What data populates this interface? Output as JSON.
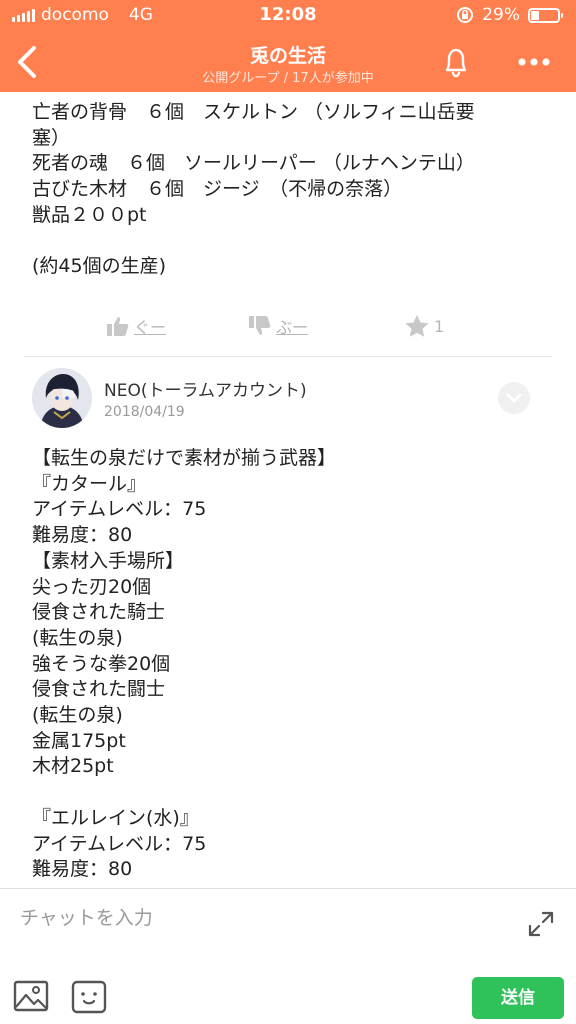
{
  "status_bar": {
    "carrier": "docomo",
    "network": "4G",
    "time": "12:08",
    "battery": "29%",
    "battery_level": 0.29
  },
  "nav": {
    "title": "兎の生活",
    "subtitle": "公開グループ / 17人が参加中"
  },
  "post1": {
    "lines": [
      "亡者の背骨　６個　スケルトン （ソルフィニ山岳要",
      "塞）",
      "死者の魂　６個　ソールリーパー （ルナヘンテ山）",
      "古びた木材　６個　ジージ　（不帰の奈落）",
      "獣品２００pt",
      "",
      "(約45個の生産)"
    ],
    "reactions": {
      "good": "ぐー",
      "boo": "ぶー",
      "star_count": "1"
    }
  },
  "post2": {
    "author": "NEO(トーラムアカウント)",
    "date": "2018/04/19",
    "lines": [
      "【転生の泉だけで素材が揃う武器】",
      "『カタール』",
      "アイテムレベル：75",
      "難易度：80",
      "【素材入手場所】",
      "尖った刃20個",
      "侵食された騎士",
      "(転生の泉)",
      "強そうな拳20個",
      "侵食された闘士",
      "(転生の泉)",
      "金属175pt",
      "木材25pt",
      "",
      "『エルレイン(水)』",
      "アイテムレベル：75",
      "難易度：80"
    ]
  },
  "input": {
    "placeholder": "チャットを入力",
    "send": "送信"
  },
  "colors": {
    "header": "#ff7f4e",
    "send": "#2fc25b",
    "reaction": "#b5b5b5"
  }
}
